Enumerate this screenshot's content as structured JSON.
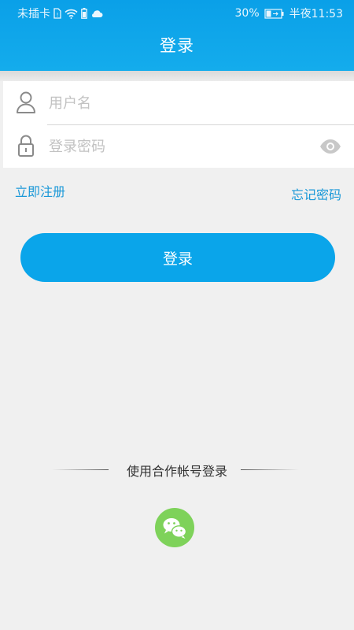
{
  "status_bar": {
    "carrier": "未插卡",
    "battery": "30%",
    "time": "半夜11:53"
  },
  "header": {
    "title": "登录"
  },
  "form": {
    "username_placeholder": "用户名",
    "password_placeholder": "登录密码"
  },
  "links": {
    "register": "立即注册",
    "forgot_password": "忘记密码"
  },
  "login_button": "登录",
  "partner_login": {
    "label": "使用合作帐号登录",
    "providers": [
      "wechat-icon"
    ]
  },
  "colors": {
    "accent": "#0aa5ea",
    "link": "#1a98d8",
    "wechat": "#7ed25a"
  }
}
